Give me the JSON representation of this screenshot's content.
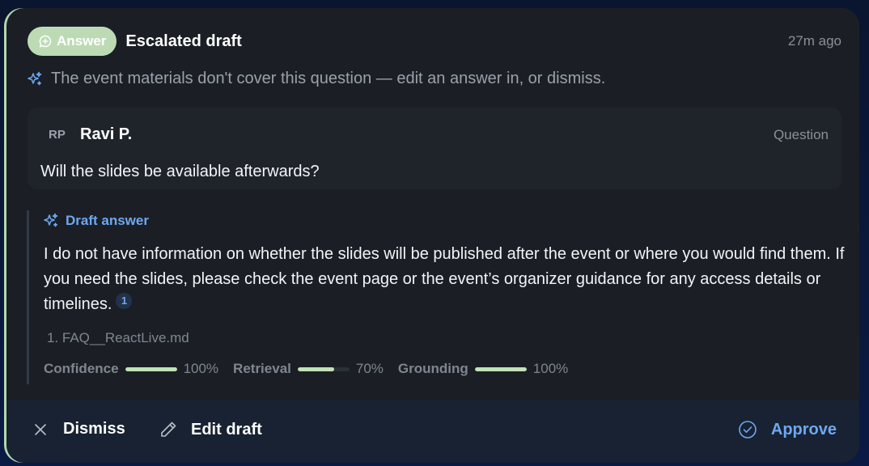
{
  "card": {
    "badge_label": "Answer",
    "title": "Escalated draft",
    "time": "27m ago",
    "notice": "The event materials don't cover this question — edit an answer in, or dismiss."
  },
  "question": {
    "avatar_initials": "RP",
    "author": "Ravi P.",
    "tag": "Question",
    "text": "Will the slides be available afterwards?"
  },
  "draft": {
    "heading": "Draft answer",
    "text": "I do not have information on whether the slides will be published after the event or where you would find them. If you need the slides, please check the event page or the event’s organizer guidance for any access details or timelines.",
    "citation": "1",
    "sources": [
      "1. FAQ__ReactLive.md"
    ]
  },
  "metrics": [
    {
      "label": "Confidence",
      "value": 100,
      "display": "100%"
    },
    {
      "label": "Retrieval",
      "value": 70,
      "display": "70%"
    },
    {
      "label": "Grounding",
      "value": 100,
      "display": "100%"
    }
  ],
  "actions": {
    "dismiss": "Dismiss",
    "edit": "Edit draft",
    "approve": "Approve"
  },
  "colors": {
    "badge": "#bcdbb5",
    "accent": "#6ea8f0",
    "metric_fill": "#c3e2b8",
    "card_bg": "#1b1f25"
  },
  "icons": {
    "badge": "chat-plus-icon",
    "notice": "sparkle-icon",
    "draft": "sparkle-icon",
    "dismiss": "close-icon",
    "edit": "pencil-icon",
    "approve": "check-circle-icon"
  }
}
